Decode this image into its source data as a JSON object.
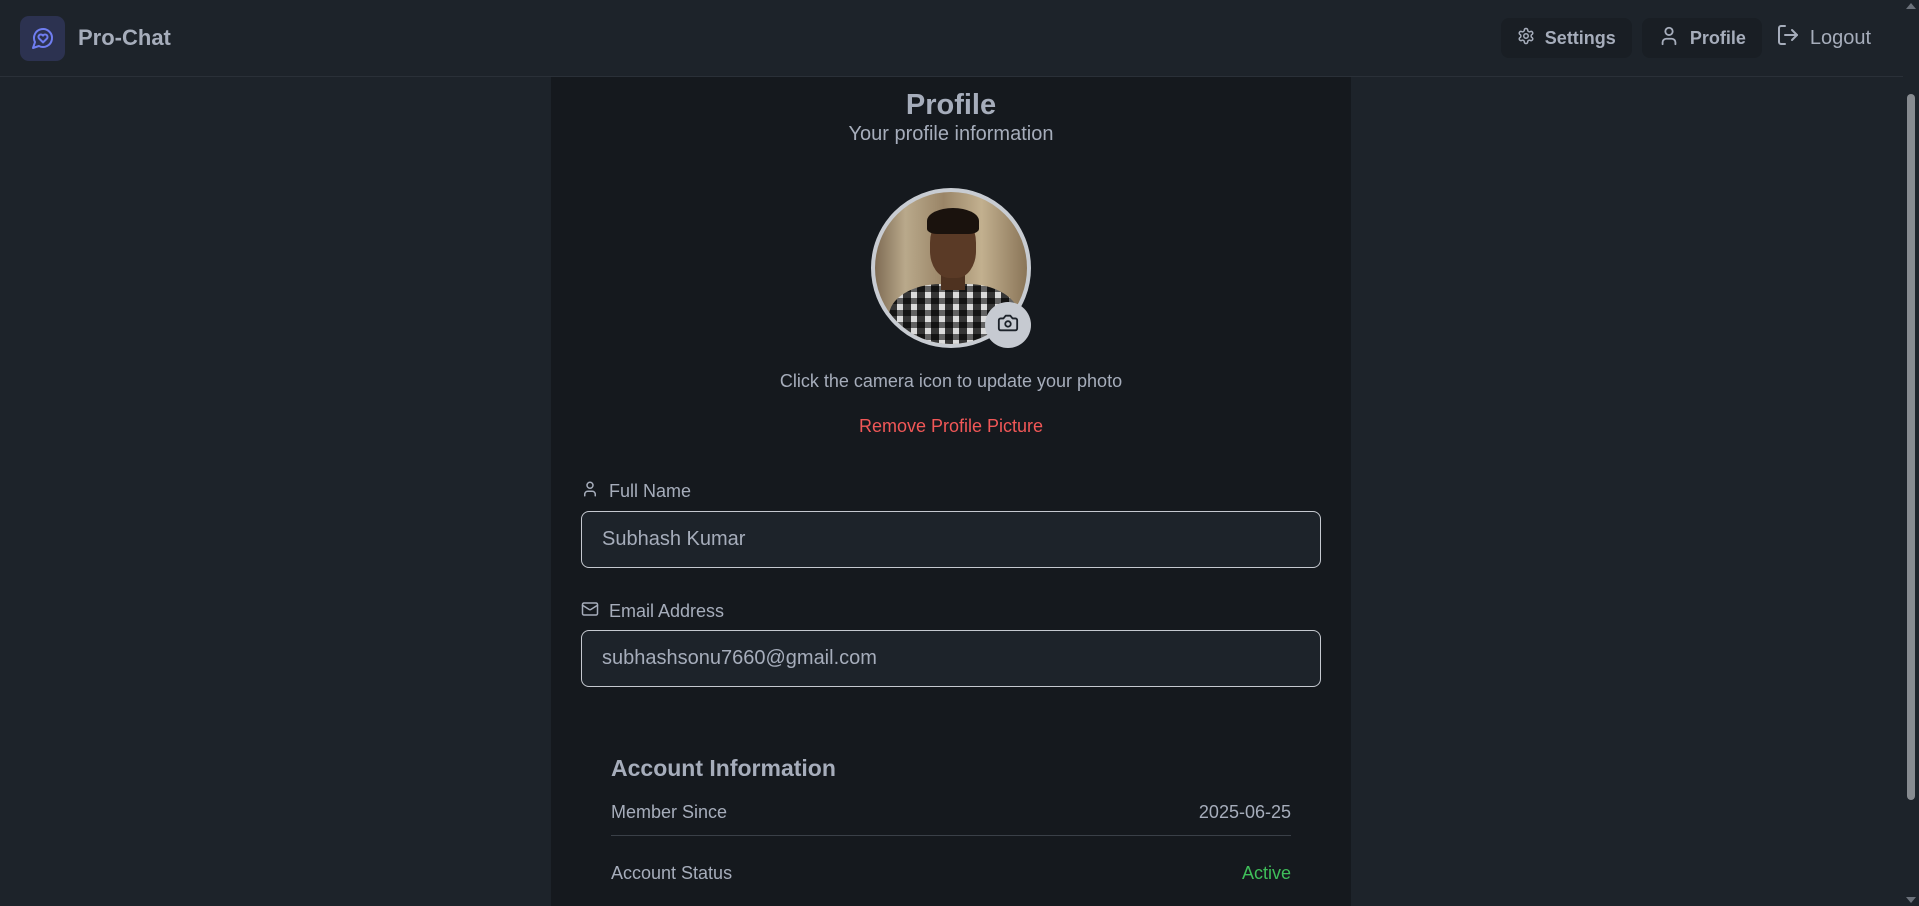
{
  "app": {
    "name": "Pro-Chat"
  },
  "nav": {
    "settings_label": "Settings",
    "profile_label": "Profile",
    "logout_label": "Logout"
  },
  "profile": {
    "title": "Profile",
    "subtitle": "Your profile information",
    "photo_hint": "Click the camera icon to update your photo",
    "remove_photo_label": "Remove Profile Picture",
    "full_name_label": "Full Name",
    "full_name_value": "Subhash Kumar",
    "email_label": "Email Address",
    "email_value": "subhashsonu7660@gmail.com"
  },
  "account": {
    "title": "Account Information",
    "rows": [
      {
        "label": "Member Since",
        "value": "2025-06-25"
      },
      {
        "label": "Account Status",
        "value": "Active"
      }
    ]
  },
  "colors": {
    "background": "#1d232a",
    "card": "#15191e",
    "danger": "#f15757",
    "success": "#3fbf5a",
    "logo_accent": "#6f7df0"
  },
  "icons": {
    "logo": "chat-heart-icon",
    "settings": "gear-icon",
    "profile": "user-icon",
    "logout": "logout-icon",
    "camera": "camera-icon",
    "name": "user-icon",
    "email": "mail-icon"
  }
}
